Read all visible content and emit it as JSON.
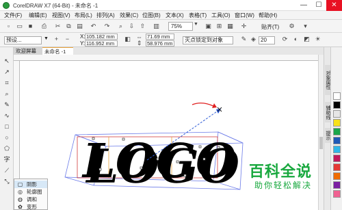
{
  "window": {
    "title": "CorelDRAW X7 (64-Bit) - 未命名 -1",
    "minimize": "—",
    "maximize": "☐",
    "close": "✕"
  },
  "menu": [
    "文件(F)",
    "编辑(E)",
    "视图(V)",
    "布局(L)",
    "排列(A)",
    "效果(C)",
    "位图(B)",
    "文本(X)",
    "表格(T)",
    "工具(O)",
    "窗口(W)",
    "帮助(H)"
  ],
  "toolbar": {
    "zoom": "75%",
    "snap": "贴齐(T)"
  },
  "property_bar": {
    "preset": "预设...",
    "x_label": "X:",
    "x_value": "105.182 mm",
    "y_label": "Y:",
    "y_value": "116.952 mm",
    "dx_value": "71.69 mm",
    "dy_value": "58.976 mm",
    "lock_mode": "灭点锁定到对象",
    "opacity": "20"
  },
  "tabs": {
    "welcome": "欢迎屏幕",
    "document": "未命名 -1"
  },
  "dockers": [
    "对象属性",
    "辅助线",
    "提示"
  ],
  "flyout": {
    "shadow": "阴影",
    "contour": "轮廓图",
    "blend": "调和",
    "distort": "变形"
  },
  "canvas": {
    "logo_text": "LOGO"
  },
  "watermark": {
    "title": "百科全说",
    "subtitle": "助你轻松解决"
  },
  "colors": {
    "accent": "#e9a33b",
    "watermark": "#18a83e",
    "close": "#e81123"
  },
  "palette": [
    "#ffffff",
    "#000000",
    "#e6e6e6",
    "#f8e11a",
    "#1aa64a",
    "#1e59b7",
    "#2fb6e8",
    "#c2185b",
    "#e53935",
    "#ef6c00",
    "#7b1fa2",
    "#f06292"
  ]
}
